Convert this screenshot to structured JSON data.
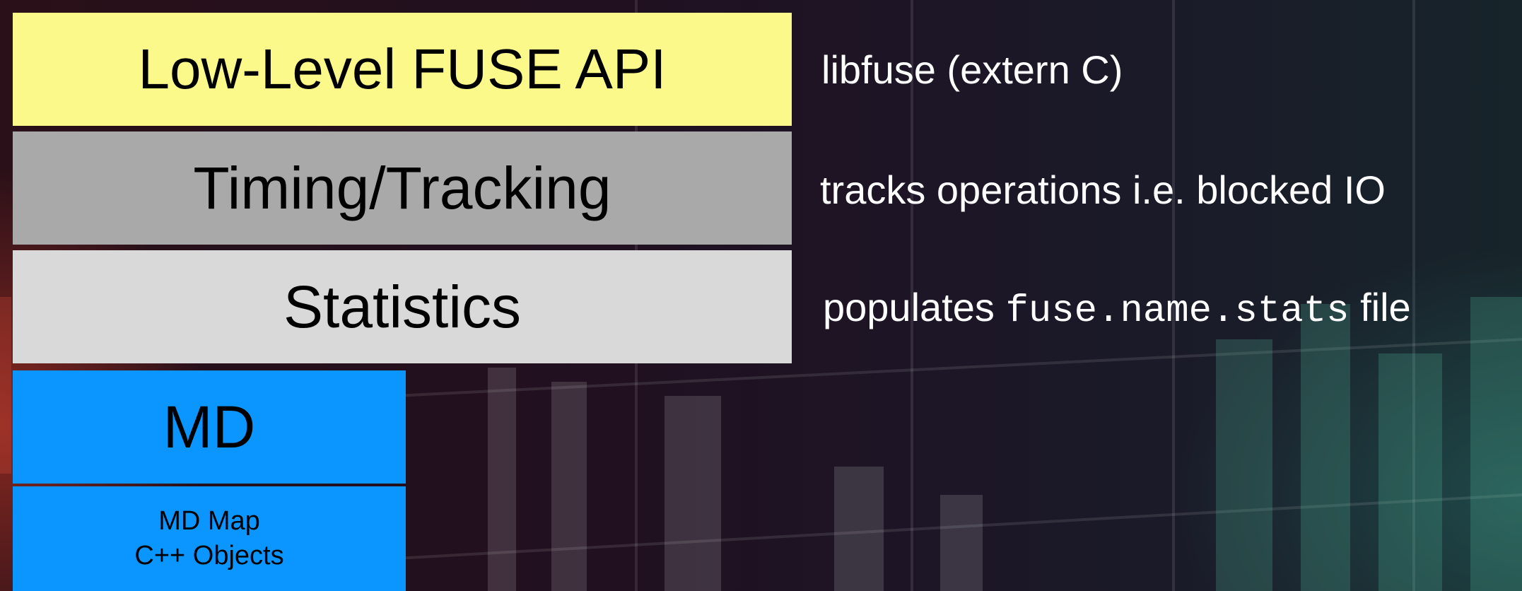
{
  "layers": {
    "fuse_api": "Low-Level FUSE API",
    "timing": "Timing/Tracking",
    "statistics": "Statistics",
    "md": "MD",
    "md_map_line1": "MD Map",
    "md_map_line2": "C++ Objects"
  },
  "descriptions": {
    "libfuse": "libfuse (extern C)",
    "tracks": "tracks operations i.e. blocked IO",
    "populates_prefix": "populates",
    "populates_code": "fuse.name.stats",
    "populates_suffix": "file"
  },
  "colors": {
    "fuse_api": "#fbf98a",
    "timing": "#a9a9a9",
    "statistics": "#d9d9d9",
    "md": "#0b96ff"
  }
}
